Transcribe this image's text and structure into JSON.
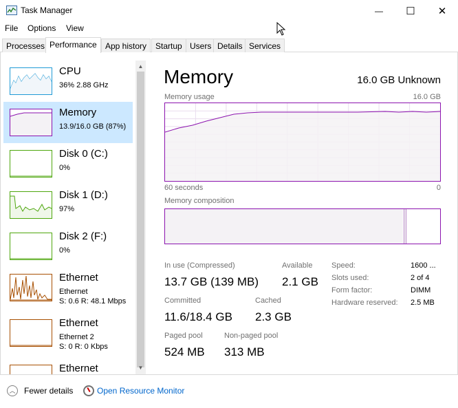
{
  "window": {
    "title": "Task Manager",
    "minimize_glyph": "—",
    "maximize_glyph": "☐",
    "close_glyph": "✕"
  },
  "menu": [
    "File",
    "Options",
    "View"
  ],
  "tabs": [
    "Processes",
    "Performance",
    "App history",
    "Startup",
    "Users",
    "Details",
    "Services"
  ],
  "active_tab": "Performance",
  "sidebar": [
    {
      "title": "CPU",
      "sub1": "36%  2.88 GHz",
      "sub2": "",
      "color": "#1f9ad6"
    },
    {
      "title": "Memory",
      "sub1": "13.9/16.0 GB (87%)",
      "sub2": "",
      "color": "#8b12ae",
      "selected": true
    },
    {
      "title": "Disk 0 (C:)",
      "sub1": "0%",
      "sub2": "",
      "color": "#4da60c"
    },
    {
      "title": "Disk 1 (D:)",
      "sub1": "97%",
      "sub2": "",
      "color": "#4da60c"
    },
    {
      "title": "Disk 2 (F:)",
      "sub1": "0%",
      "sub2": "",
      "color": "#4da60c"
    },
    {
      "title": "Ethernet",
      "sub1": "Ethernet",
      "sub2": "S: 0.6  R: 48.1 Mbps",
      "color": "#a74f01"
    },
    {
      "title": "Ethernet",
      "sub1": "Ethernet 2",
      "sub2": "S: 0  R: 0 Kbps",
      "color": "#a74f01"
    },
    {
      "title": "Ethernet",
      "sub1": "",
      "sub2": "",
      "color": "#a74f01"
    }
  ],
  "main": {
    "title": "Memory",
    "spec": "16.0 GB Unknown",
    "usage_label": "Memory usage",
    "usage_max": "16.0 GB",
    "time_left": "60 seconds",
    "time_right": "0",
    "composition_label": "Memory composition",
    "usage_fraction": 0.87
  },
  "stats": {
    "in_use_label": "In use (Compressed)",
    "in_use_value": "13.7 GB (139 MB)",
    "available_label": "Available",
    "available_value": "2.1 GB",
    "committed_label": "Committed",
    "committed_value": "11.6/18.4 GB",
    "cached_label": "Cached",
    "cached_value": "2.3 GB",
    "paged_label": "Paged pool",
    "paged_value": "524 MB",
    "nonpaged_label": "Non-paged pool",
    "nonpaged_value": "313 MB"
  },
  "details": [
    {
      "key": "Speed:",
      "value": "1600 ..."
    },
    {
      "key": "Slots used:",
      "value": "2 of 4"
    },
    {
      "key": "Form factor:",
      "value": "DIMM"
    },
    {
      "key": "Hardware reserved:",
      "value": "2.5 MB"
    }
  ],
  "footer": {
    "fewer_details": "Fewer details",
    "open_resource_monitor": "Open Resource Monitor"
  }
}
